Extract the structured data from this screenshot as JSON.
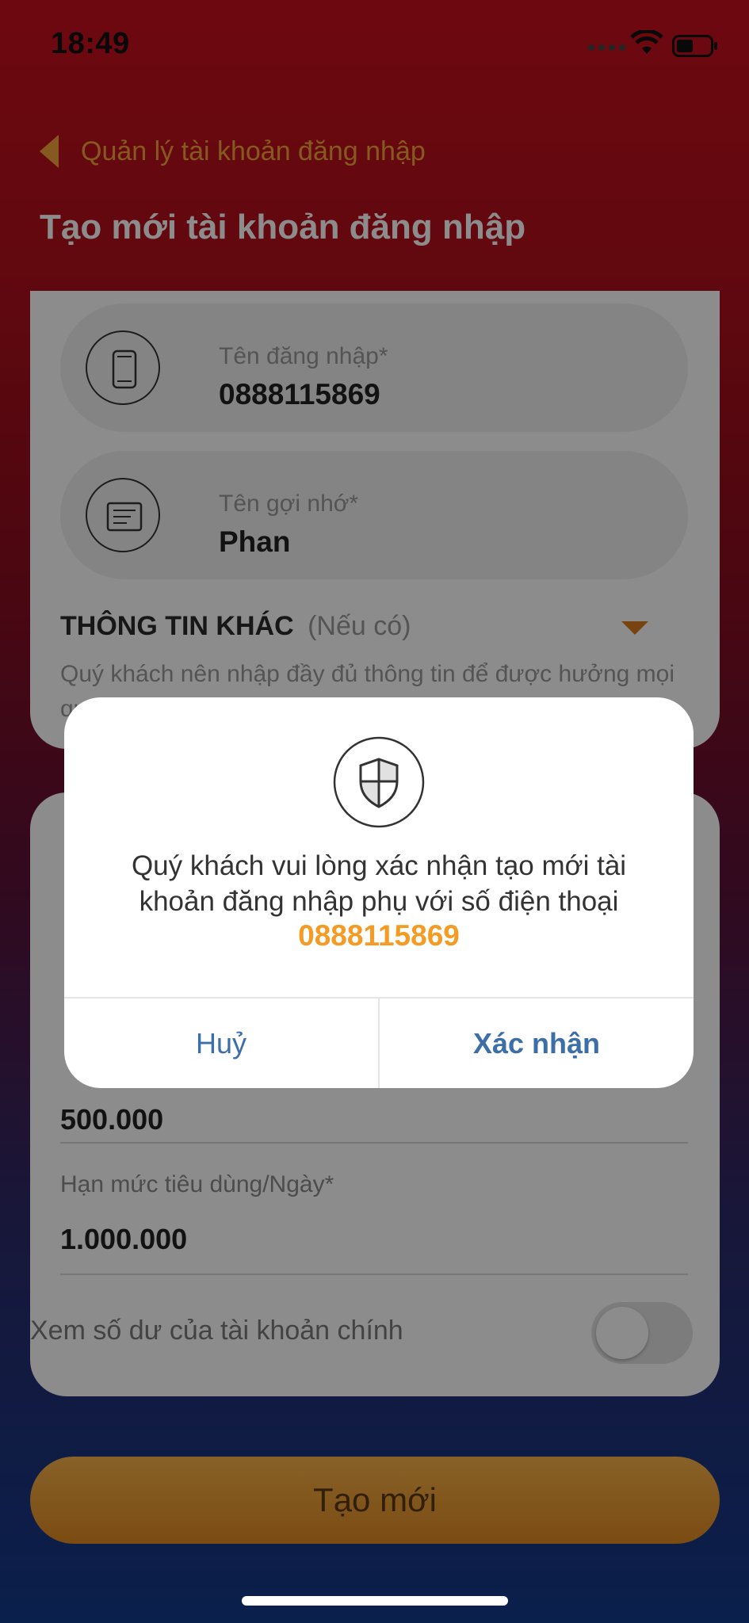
{
  "status_bar": {
    "time": "18:49"
  },
  "header": {
    "back_label": "Quản lý tài khoản đăng nhập",
    "title": "Tạo mới tài khoản đăng nhập"
  },
  "form": {
    "username": {
      "label": "Tên đăng nhập*",
      "value": "0888115869",
      "icon": "phone-icon"
    },
    "nickname": {
      "label": "Tên gợi nhớ*",
      "value": "Phan",
      "icon": "note-icon"
    },
    "other_info": {
      "title": "THÔNG TIN KHÁC",
      "optional": "(Nếu có)",
      "description": "Quý khách nên nhập đầy đủ thông tin để được hưởng mọi quyền lợi khi sử dụng Ví điện tử VNPAY"
    },
    "limits": {
      "per_transaction_value": "500.000",
      "daily_label": "Hạn mức tiêu dùng/Ngày*",
      "daily_value": "1.000.000"
    },
    "view_balance": {
      "label": "Xem số dư của tài khoản chính",
      "enabled": false
    }
  },
  "create_button": "Tạo mới",
  "dialog": {
    "icon": "shield-icon",
    "message": "Quý khách vui lòng xác nhận tạo mới tài khoản đăng nhập phụ với số điện thoại",
    "phone": "0888115869",
    "cancel_label": "Huỷ",
    "confirm_label": "Xác nhận"
  },
  "colors": {
    "accent_orange": "#f59a23",
    "link_blue": "#3c6ea8",
    "header_red": "#c8101e"
  }
}
